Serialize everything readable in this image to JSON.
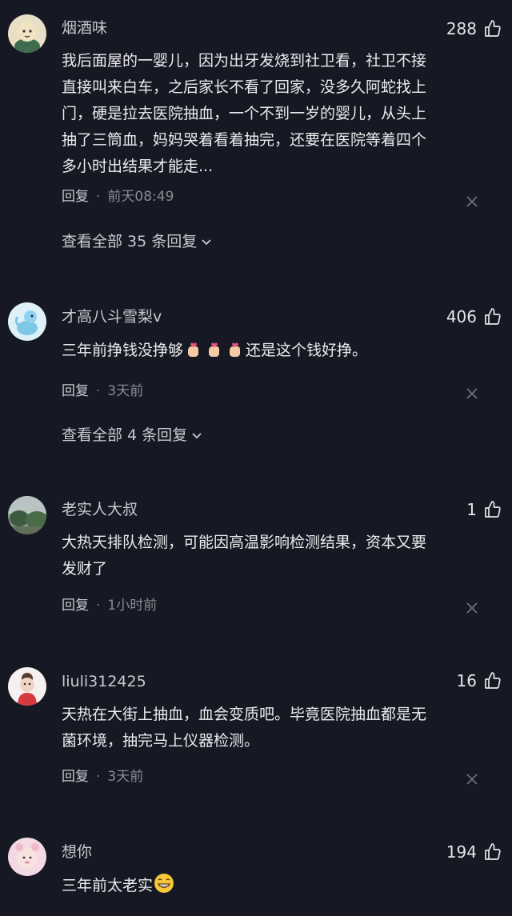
{
  "comments": [
    {
      "username": "烟酒味",
      "likes": "288",
      "text_lines": [
        "我后面屋的一婴儿，因为出牙发烧到社卫看，社卫不接",
        "直接叫来白车，之后家长不看了回家，没多久阿蛇找上",
        "门，硬是拉去医院抽血，一个不到一岁的婴儿，从头上",
        "抽了三筒血，妈妈哭着看着抽完，还要在医院等着四个",
        "多小时出结果才能走..."
      ],
      "reply_label": "回复",
      "dot": "·",
      "time": "前天08:49",
      "view_replies": "查看全部 35 条回复"
    },
    {
      "username": "才高八斗雪梨v",
      "likes": "406",
      "text_before": "三年前挣钱没挣够",
      "text_after": "还是这个钱好挣。",
      "reply_label": "回复",
      "dot": "·",
      "time": "3天前",
      "view_replies": "查看全部 4 条回复"
    },
    {
      "username": "老实人大叔",
      "likes": "1",
      "text_lines": [
        "大热天排队检测，可能因高温影响检测结果，资本又要",
        "发财了"
      ],
      "reply_label": "回复",
      "dot": "·",
      "time": "1小时前"
    },
    {
      "username": "liuli312425",
      "likes": "16",
      "text_lines": [
        "天热在大街上抽血，血会变质吧。毕竟医院抽血都是无",
        "菌环境，抽完马上仪器检测。"
      ],
      "reply_label": "回复",
      "dot": "·",
      "time": "3天前"
    },
    {
      "username": "想你",
      "likes": "194",
      "text_before": "三年前太老实",
      "emoji": "grinning-face"
    }
  ],
  "colors": {
    "background": "#161823",
    "text": "#ececee",
    "secondary": "#8a8b93"
  }
}
